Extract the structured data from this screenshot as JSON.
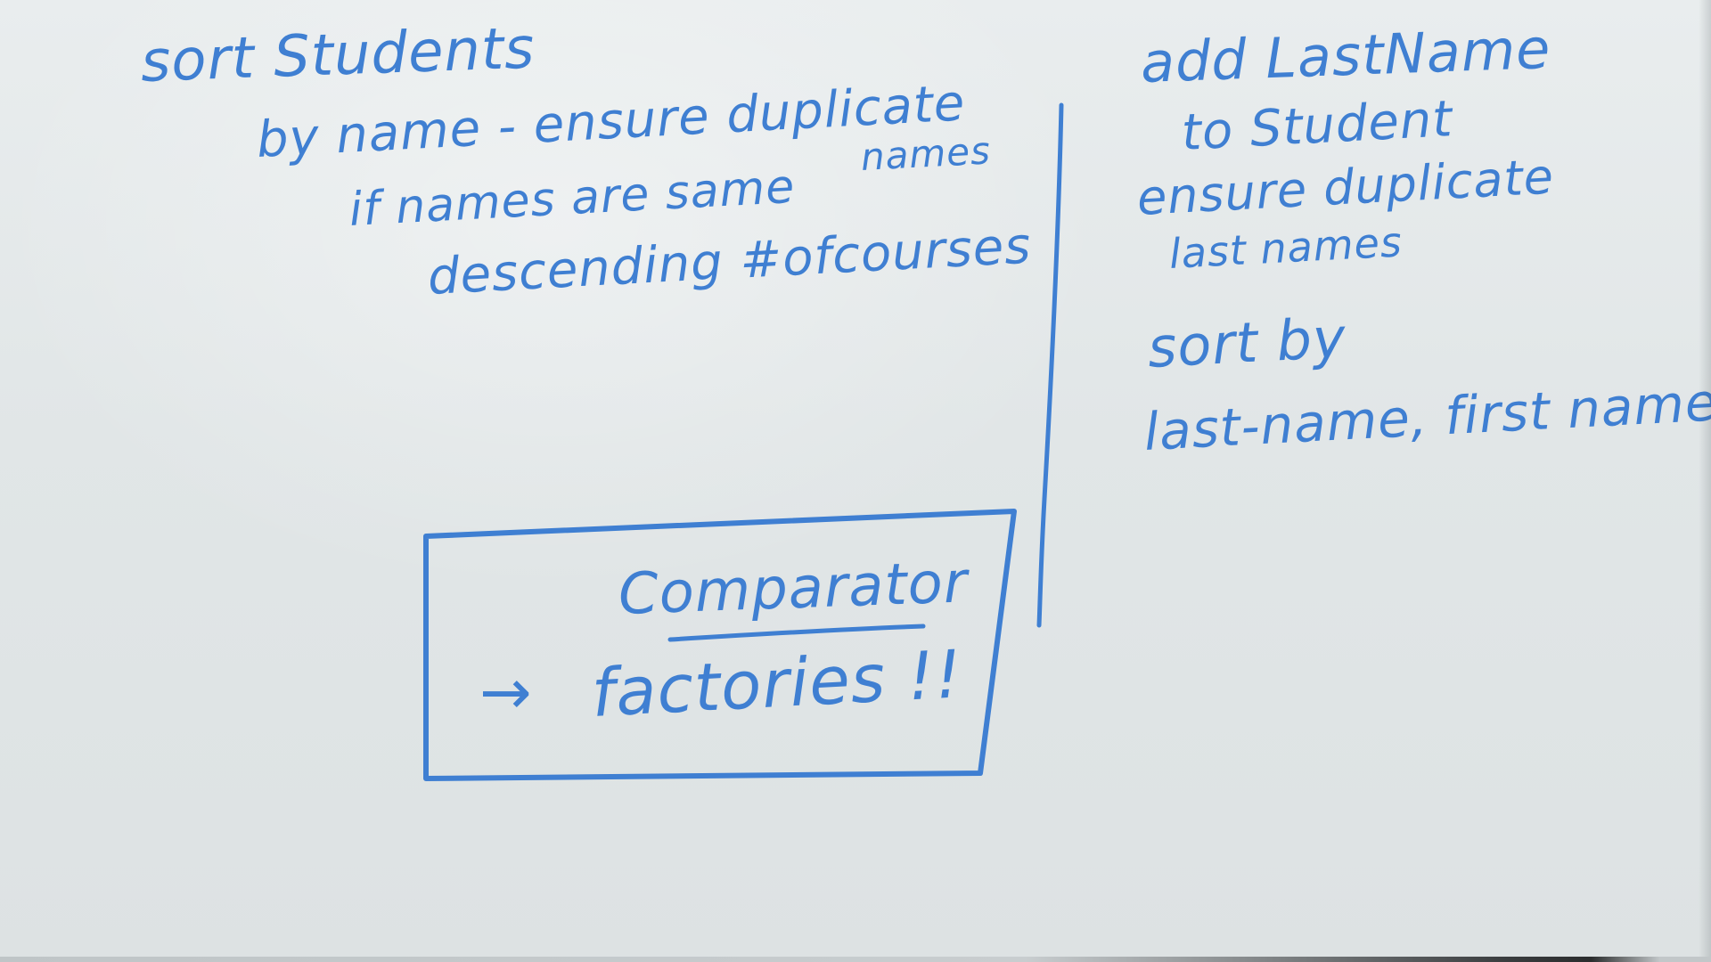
{
  "ink_color": "#3f7fd2",
  "left_notes": {
    "title": "sort Students",
    "line1": "by name - ensure duplicate",
    "line1_cont": "names",
    "line2": "if names are same",
    "line3": "descending #ofcourses"
  },
  "right_notes": {
    "line1": "add LastName",
    "line2": "to Student",
    "line3": "ensure duplicate",
    "line4": "last names",
    "line5": "sort by",
    "line6": "last-name, first name"
  },
  "box": {
    "heading": "Comparator",
    "arrow": "→",
    "body": "factories !!"
  }
}
